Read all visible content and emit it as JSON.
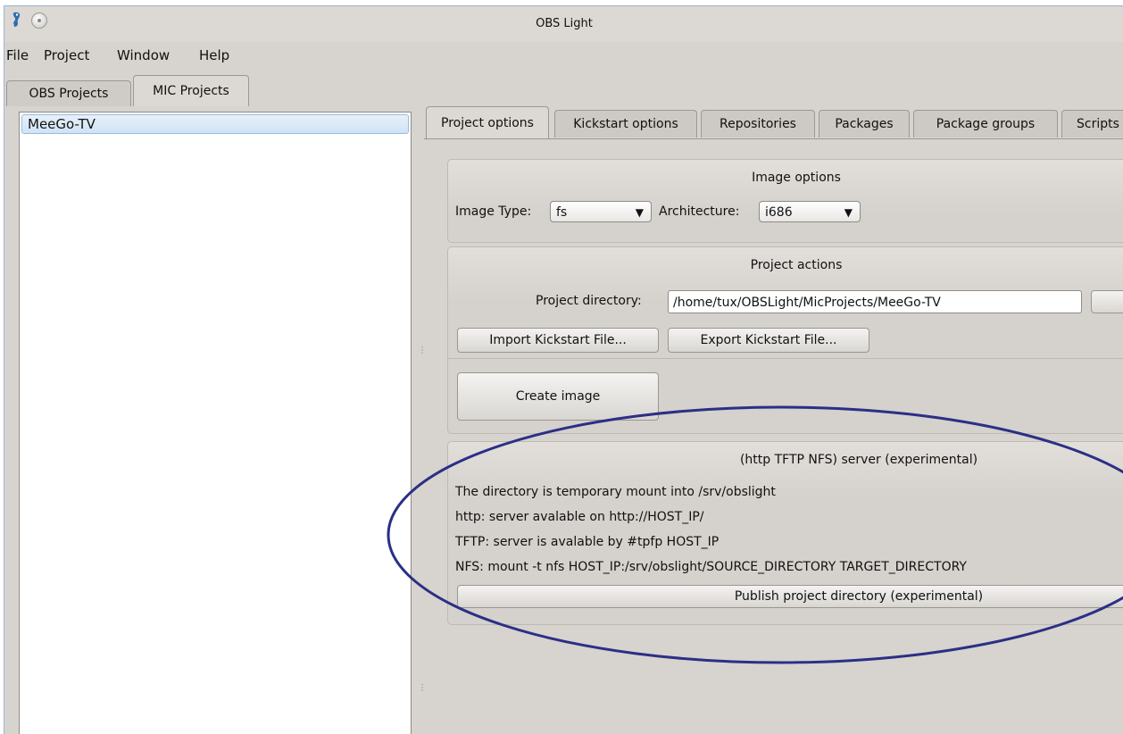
{
  "window": {
    "title": "OBS Light"
  },
  "menubar": {
    "items": [
      "File",
      "Project",
      "Window",
      "Help"
    ]
  },
  "outer_tabs": [
    {
      "label": "OBS Projects"
    },
    {
      "label": "MIC Projects"
    }
  ],
  "project_list": {
    "items": [
      "MeeGo-TV"
    ]
  },
  "inner_tabs": [
    {
      "label": "Project options"
    },
    {
      "label": "Kickstart options"
    },
    {
      "label": "Repositories"
    },
    {
      "label": "Packages"
    },
    {
      "label": "Package groups"
    },
    {
      "label": "Scripts"
    }
  ],
  "image_options": {
    "title": "Image options",
    "image_type_label": "Image Type:",
    "image_type_value": "fs",
    "architecture_label": "Architecture:",
    "architecture_value": "i686"
  },
  "project_actions": {
    "title": "Project actions",
    "directory_label": "Project directory:",
    "directory_value": "/home/tux/OBSLight/MicProjects/MeeGo-TV",
    "import_button": "Import Kickstart File...",
    "export_button": "Export Kickstart File...",
    "create_button": "Create image"
  },
  "server": {
    "title": "(http TFTP NFS) server (experimental)",
    "lines": [
      "The directory is temporary mount into /srv/obslight",
      "http: server avalable on http://HOST_IP/",
      "TFTP: server is avalable by #tpfp HOST_IP",
      "NFS: mount -t nfs  HOST_IP:/srv/obslight/SOURCE_DIRECTORY TARGET_DIRECTORY"
    ],
    "publish_button": "Publish project directory (experimental)"
  },
  "colors": {
    "annotation_ellipse": "#2b2f86",
    "selection": "#cfe3f5"
  }
}
